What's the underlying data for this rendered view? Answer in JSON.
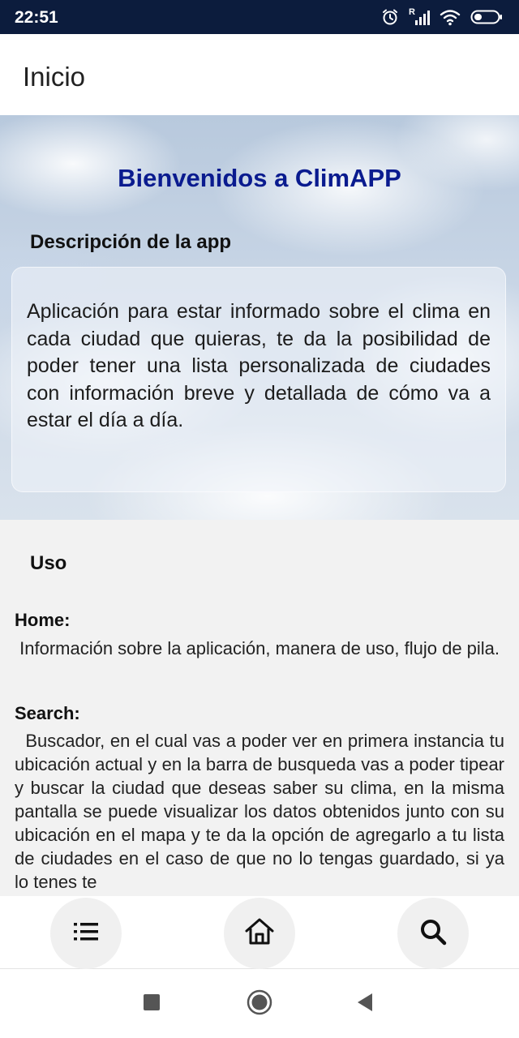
{
  "status_bar": {
    "time": "22:51",
    "icons": [
      "alarm-icon",
      "signal-icon",
      "wifi-icon",
      "battery-icon"
    ],
    "signal_label": "R"
  },
  "app_bar": {
    "title": "Inicio"
  },
  "hero": {
    "welcome": "Bienvenidos a ClimAPP",
    "description_title": "Descripción de la app",
    "description_text": "Aplicación para estar informado sobre el clima en cada ciudad que quieras, te da la posibilidad de poder tener una lista personalizada de ciudades con información breve y detallada de cómo va a estar el día a día."
  },
  "usage": {
    "title": "Uso",
    "sections": [
      {
        "title": "Home:",
        "text": " Información sobre la aplicación, manera de uso, flujo de pila."
      },
      {
        "title": "Search:",
        "text": "  Buscador, en el cual vas a poder ver en primera instancia tu ubicación actual y en la barra de busqueda vas a poder tipear y buscar la ciudad que deseas saber su clima, en la misma pantalla se puede visualizar los datos obtenidos junto con su ubicación en el mapa y te da la opción de agregarlo a tu lista de ciudades en el caso de que no lo tengas guardado, si ya lo tenes te"
      }
    ]
  },
  "bottom_nav": {
    "items": [
      "list-icon",
      "home-icon",
      "search-icon"
    ]
  },
  "system_nav": {
    "items": [
      "recent-apps-icon",
      "home-circle-icon",
      "back-icon"
    ]
  },
  "colors": {
    "status_bar_bg": "#0c1c3d",
    "welcome_text": "#0a1b8f",
    "content_bg": "#f2f2f2"
  }
}
